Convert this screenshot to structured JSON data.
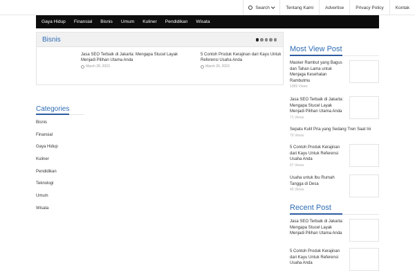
{
  "topnav": {
    "search_label": "Search",
    "links": [
      "Tentang Kami",
      "Advertise",
      "Privacy Policy",
      "Kontak"
    ]
  },
  "mainnav": {
    "items": [
      "Gaya Hidup",
      "Finansial",
      "Bisnis",
      "Umum",
      "Kuliner",
      "Pendidikan",
      "Wisata"
    ]
  },
  "bisnis": {
    "title": "Bisnis",
    "posts": [
      {
        "title": "Jasa SEO Terbaik di Jakarta: Mengapa Stucel Layak Menjadi Pilihan Utama Anda",
        "date": "March 28, 2023"
      },
      {
        "title": "5 Contoh Produk Kerajinan dari Kayu Untuk Referensi Usaha Anda",
        "date": "March 26, 2023"
      }
    ]
  },
  "categories": {
    "title": "Categories",
    "items": [
      "Bisnis",
      "Finansial",
      "Gaya Hidup",
      "Kuliner",
      "Pendidikan",
      "Teknologi",
      "Umum",
      "Wisata"
    ]
  },
  "most_view": {
    "title": "Most View Post",
    "posts": [
      {
        "title": "Masker Rambut yang Bagus dan Tahan Lama untuk Menjaga Kesehatan Rambutmu",
        "views": "1089 Views"
      },
      {
        "title": "Jasa SEO Terbaik di Jakarta: Mengapa Stucel Layak Menjadi Pilihan Utama Anda",
        "views": "71 Views"
      },
      {
        "title": "Sepatu Kulit Pria yang Sedang Tren Saat Ini",
        "views": "70 Views"
      },
      {
        "title": "5 Contoh Produk Kerajinan dari Kayu Untuk Referensi Usaha Anda",
        "views": "67 Views"
      },
      {
        "title": "Usaha untuk Ibu Rumah Tangga di Desa",
        "views": "45 Views"
      }
    ]
  },
  "recent": {
    "title": "Recent Post",
    "posts": [
      {
        "title": "Jasa SEO Terbaik di Jakarta: Mengapa Stucel Layak Menjadi Pilihan Utama Anda"
      },
      {
        "title": "5 Contoh Produk Kerajinan dari Kayu Untuk Referensi Usaha Anda"
      }
    ]
  },
  "colors": {
    "accent": "#2c6bb5",
    "nav_bg": "#0d0d0d"
  }
}
